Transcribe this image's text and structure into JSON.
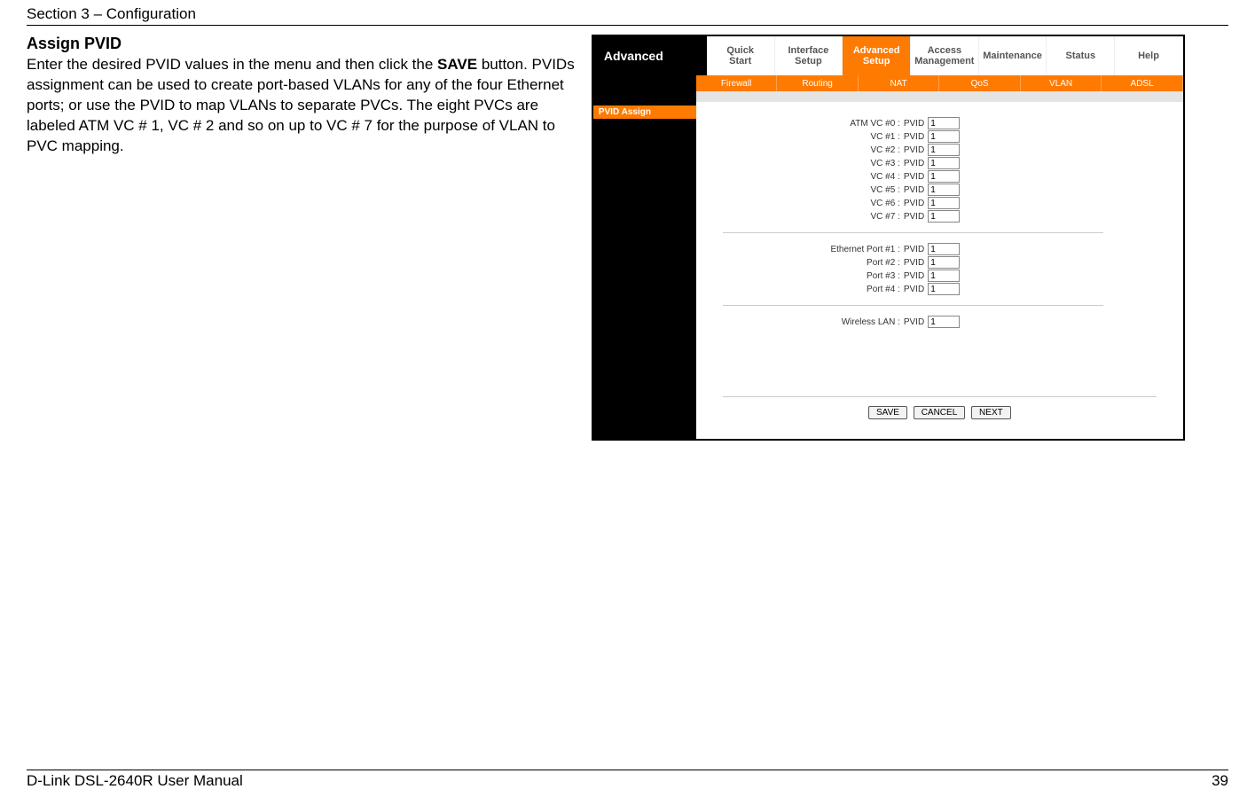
{
  "header": {
    "section": "Section 3 – Configuration"
  },
  "left": {
    "title": "Assign PVID",
    "desc_before": "Enter the desired PVID values in the menu and then click the ",
    "save_word": "SAVE",
    "desc_after": " button. PVIDs assignment can be used to create port-based VLANs for any of the four Ethernet ports; or use the PVID to map VLANs to separate PVCs. The eight PVCs are labeled ATM VC # 1, VC # 2 and so on up to VC # 7 for the purpose of VLAN to PVC mapping."
  },
  "router": {
    "brand": "Advanced",
    "topTabs": [
      {
        "l1": "Quick",
        "l2": "Start"
      },
      {
        "l1": "Interface",
        "l2": "Setup"
      },
      {
        "l1": "Advanced",
        "l2": "Setup",
        "active": true
      },
      {
        "l1": "Access",
        "l2": "Management"
      },
      {
        "l1": "Maintenance",
        "l2": ""
      },
      {
        "l1": "Status",
        "l2": ""
      },
      {
        "l1": "Help",
        "l2": ""
      }
    ],
    "subTabs": [
      "Firewall",
      "Routing",
      "NAT",
      "QoS",
      "VLAN",
      "ADSL"
    ],
    "sideLabel": "PVID Assign",
    "pvidWord": "PVID",
    "rows_vc": [
      {
        "label": "ATM VC #0 :",
        "value": "1"
      },
      {
        "label": "VC #1 :",
        "value": "1"
      },
      {
        "label": "VC #2 :",
        "value": "1"
      },
      {
        "label": "VC #3 :",
        "value": "1"
      },
      {
        "label": "VC #4 :",
        "value": "1"
      },
      {
        "label": "VC #5 :",
        "value": "1"
      },
      {
        "label": "VC #6 :",
        "value": "1"
      },
      {
        "label": "VC #7 :",
        "value": "1"
      }
    ],
    "rows_port": [
      {
        "label": "Ethernet Port #1 :",
        "value": "1"
      },
      {
        "label": "Port #2 :",
        "value": "1"
      },
      {
        "label": "Port #3 :",
        "value": "1"
      },
      {
        "label": "Port #4 :",
        "value": "1"
      }
    ],
    "rows_wlan": [
      {
        "label": "Wireless LAN :",
        "value": "1"
      }
    ],
    "buttons": {
      "save": "SAVE",
      "cancel": "CANCEL",
      "next": "NEXT"
    }
  },
  "footer": {
    "left": "D-Link DSL-2640R User Manual",
    "right": "39"
  }
}
